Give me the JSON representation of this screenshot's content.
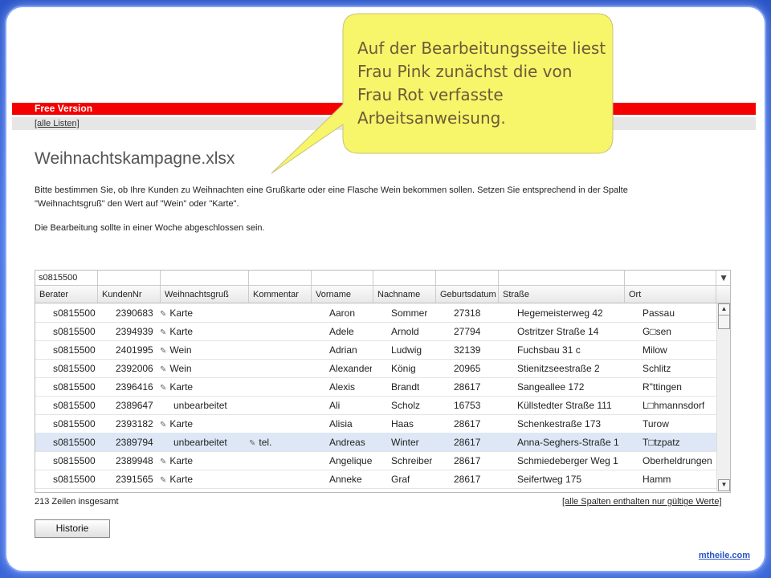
{
  "header": {
    "free_label": "Free Version",
    "all_lists_link": "[alle Listen]"
  },
  "page": {
    "title": "Weihnachtskampagne.xlsx",
    "description_line1": "Bitte bestimmen Sie, ob Ihre Kunden zu Weihnachten eine Grußkarte oder eine Flasche Wein bekommen sollen. Setzen Sie entsprechend in der Spalte",
    "description_line2": "\"Weihnachtsgruß\" den Wert auf \"Wein\" oder \"Karte\".",
    "deadline": "Die Bearbeitung sollte in einer Woche abgeschlossen sein."
  },
  "grid": {
    "filter_value": "s0815500",
    "columns": [
      "Berater",
      "KundenNr",
      "Weihnachtsgruß",
      "Kommentar",
      "Vorname",
      "Nachname",
      "Geburtsdatum",
      "Straße",
      "Ort"
    ],
    "rows": [
      [
        "s0815500",
        "2390683",
        "Karte",
        "",
        "Aaron",
        "Sommer",
        "27318",
        "Hegemeisterweg 42",
        "Passau"
      ],
      [
        "s0815500",
        "2394939",
        "Karte",
        "",
        "Adele",
        "Arnold",
        "27794",
        "Ostritzer Straße 14",
        "G□sen"
      ],
      [
        "s0815500",
        "2401995",
        "Wein",
        "",
        "Adrian",
        "Ludwig",
        "32139",
        "Fuchsbau 31 c",
        "Milow"
      ],
      [
        "s0815500",
        "2392006",
        "Wein",
        "",
        "Alexander",
        "König",
        "20965",
        "Stienitzseestraße 2",
        "Schlitz"
      ],
      [
        "s0815500",
        "2396416",
        "Karte",
        "",
        "Alexis",
        "Brandt",
        "28617",
        "Sangeallee 172",
        "R\"ttingen"
      ],
      [
        "s0815500",
        "2389647",
        "unbearbeitet",
        "",
        "Ali",
        "Scholz",
        "16753",
        "Küllstedter Straße 111",
        "L□hmannsdorf"
      ],
      [
        "s0815500",
        "2393182",
        "Karte",
        "",
        "Alisia",
        "Haas",
        "28617",
        "Schenkestraße 173",
        "Turow"
      ],
      [
        "s0815500",
        "2389794",
        "unbearbeitet",
        "tel.",
        "Andreas",
        "Winter",
        "28617",
        "Anna-Seghers-Straße 1",
        "T□tzpatz"
      ],
      [
        "s0815500",
        "2389948",
        "Karte",
        "",
        "Angelique",
        "Schreiber",
        "28617",
        "Schmiedeberger Weg 1",
        "Oberheldrungen"
      ],
      [
        "s0815500",
        "2391565",
        "Karte",
        "",
        "Anneke",
        "Graf",
        "28617",
        "Seifertweg 175",
        "Hamm"
      ]
    ],
    "selected_row": 7,
    "total_label": "213 Zeilen insgesamt",
    "valid_link": "[alle Spalten enthalten nur gültige Werte]"
  },
  "history_button": "Historie",
  "logo": "mtheile.com",
  "callout": {
    "line1": "Auf der Bearbeitungsseite liest",
    "line2": "Frau Pink zunächst die von",
    "line3": "Frau Rot verfasste",
    "line4": "Arbeitsanweisung."
  },
  "colors": {
    "red_bar": "#f40000",
    "callout_fill": "#f7f56a",
    "selected_row": "#dde7f5",
    "logo": "#2a55c8"
  }
}
